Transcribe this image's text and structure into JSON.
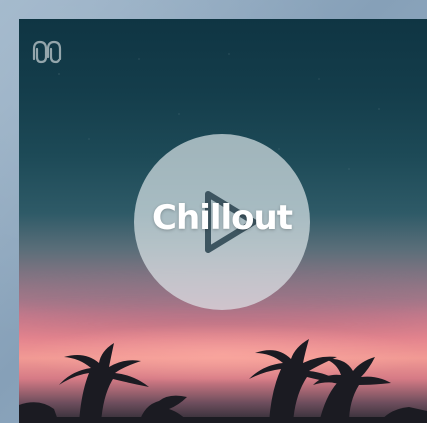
{
  "playlist": {
    "title": "Chillout"
  },
  "icons": {
    "logo": "wave-logo-icon",
    "play": "play-icon"
  },
  "colors": {
    "background": "#8fa7bd",
    "sky_top": "#0f3543",
    "sunset": "#f19a94",
    "play_disc": "#e1ebee",
    "play_icon": "#3d5560",
    "title_text": "#ffffff"
  }
}
